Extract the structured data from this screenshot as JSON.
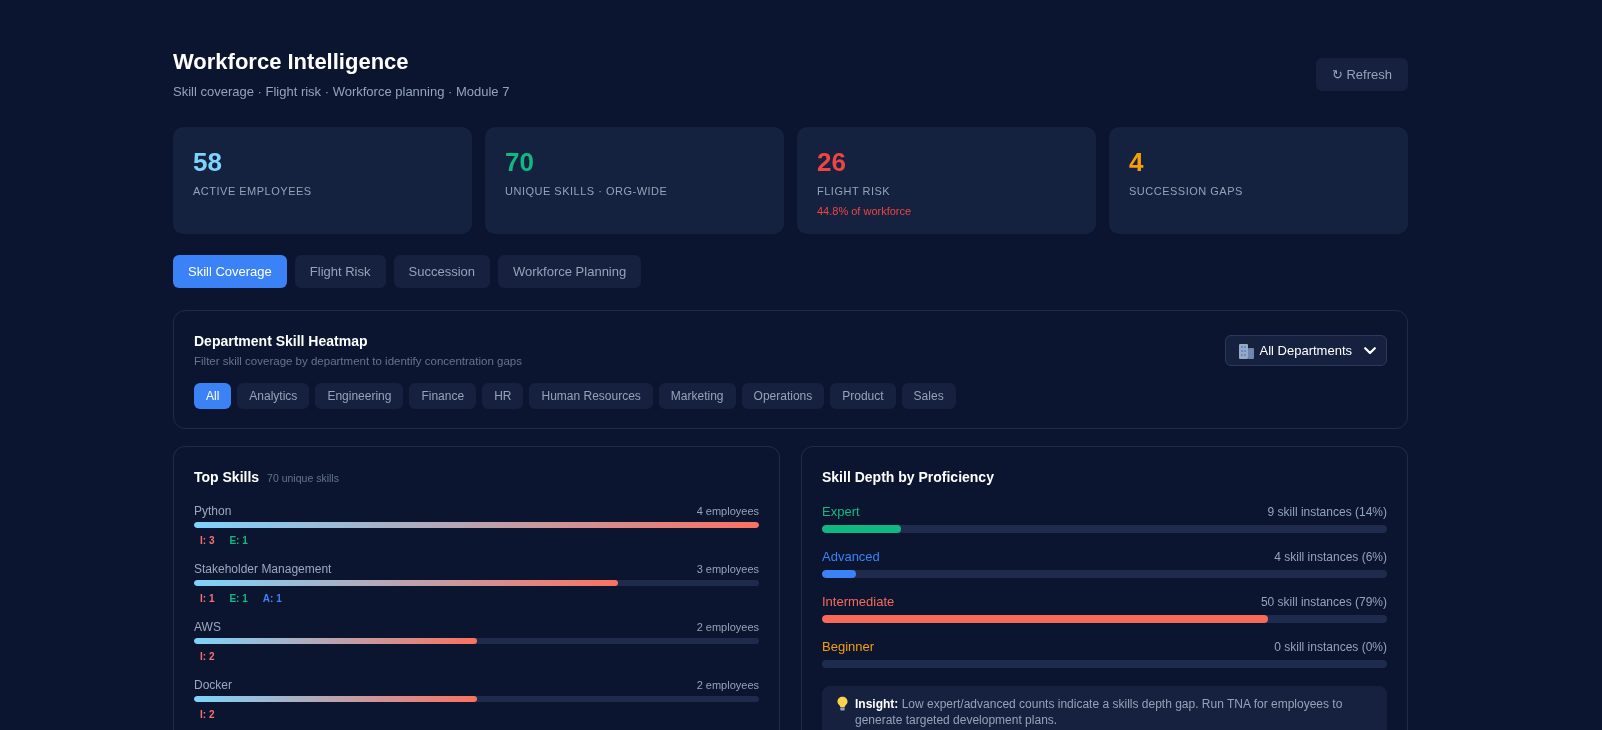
{
  "header": {
    "title": "Workforce Intelligence",
    "subtitle": "Skill coverage · Flight risk · Workforce planning · Module 7",
    "refresh_button": "↻ Refresh"
  },
  "kpis": [
    {
      "value": "58",
      "label": "ACTIVE EMPLOYEES",
      "color": "#7dd3fc"
    },
    {
      "value": "70",
      "label": "UNIQUE SKILLS · ORG-WIDE",
      "color": "#10b981"
    },
    {
      "value": "26",
      "label": "FLIGHT RISK",
      "note": "44.8% of workforce",
      "color": "#ef4444"
    },
    {
      "value": "4",
      "label": "SUCCESSION GAPS",
      "color": "#f59e0b"
    }
  ],
  "tabs": [
    {
      "label": "Skill Coverage",
      "selected": true
    },
    {
      "label": "Flight Risk",
      "selected": false
    },
    {
      "label": "Succession",
      "selected": false
    },
    {
      "label": "Workforce Planning",
      "selected": false
    }
  ],
  "heatmap": {
    "title": "Department Skill Heatmap",
    "subtitle": "Filter skill coverage by department to identify concentration gaps",
    "department_select": "All Departments",
    "departments": [
      {
        "label": "All",
        "selected": true
      },
      {
        "label": "Analytics",
        "selected": false
      },
      {
        "label": "Engineering",
        "selected": false
      },
      {
        "label": "Finance",
        "selected": false
      },
      {
        "label": "HR",
        "selected": false
      },
      {
        "label": "Human Resources",
        "selected": false
      },
      {
        "label": "Marketing",
        "selected": false
      },
      {
        "label": "Operations",
        "selected": false
      },
      {
        "label": "Product",
        "selected": false
      },
      {
        "label": "Sales",
        "selected": false
      }
    ]
  },
  "top_skills": {
    "title": "Top Skills",
    "count": "70 unique skills",
    "skills": [
      {
        "name": "Python",
        "employees": "4 employees",
        "level": 1,
        "tags": [
          {
            "text": "I: 3",
            "color": "#f87171"
          },
          {
            "text": "E: 1",
            "color": "#10b981"
          }
        ]
      },
      {
        "name": "Stakeholder Management",
        "employees": "3 employees",
        "level": 0.75,
        "tags": [
          {
            "text": "I: 1",
            "color": "#f87171"
          },
          {
            "text": "E: 1",
            "color": "#10b981"
          },
          {
            "text": "A: 1",
            "color": "#3b82f6"
          }
        ]
      },
      {
        "name": "AWS",
        "employees": "2 employees",
        "level": 0.5,
        "tags": [
          {
            "text": "I: 2",
            "color": "#f87171"
          }
        ]
      },
      {
        "name": "Docker",
        "employees": "2 employees",
        "level": 0.5,
        "tags": [
          {
            "text": "I: 2",
            "color": "#f87171"
          }
        ]
      }
    ]
  },
  "skill_depth": {
    "title": "Skill Depth by Proficiency",
    "levels": [
      {
        "name": "Expert",
        "reading": "9 skill instances (14%)",
        "level": 0.14,
        "color": "#10b981"
      },
      {
        "name": "Advanced",
        "reading": "4 skill instances (6%)",
        "level": 0.06,
        "color": "#3b82f6"
      },
      {
        "name": "Intermediate",
        "reading": "50 skill instances (79%)",
        "level": 0.79,
        "color": "#f8695a"
      },
      {
        "name": "Beginner",
        "reading": "0 skill instances (0%)",
        "level": 0,
        "color": "#f59e0b"
      }
    ],
    "insight": "**Insight:** Low expert/advanced counts indicate a skills depth gap. Run TNA for employees to generate targeted development plans."
  }
}
